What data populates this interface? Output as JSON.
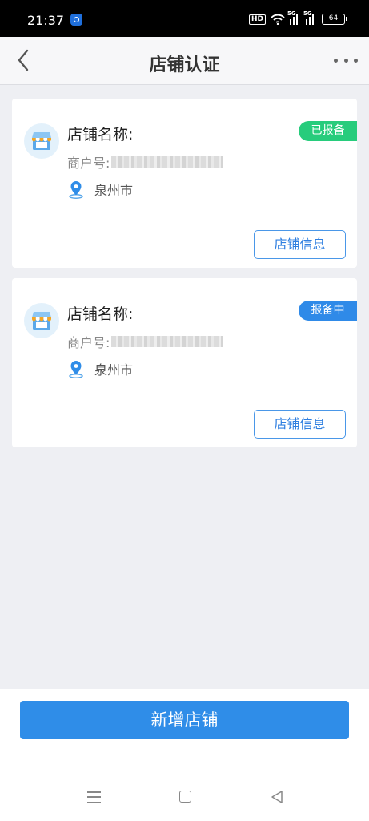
{
  "status_bar": {
    "time": "21:37",
    "hd": "HD",
    "network_1": "5G",
    "network_2": "5G",
    "battery": "64"
  },
  "nav": {
    "title": "店铺认证"
  },
  "stores": [
    {
      "name_label": "店铺名称:",
      "merchant_label": "商户号:",
      "city": "泉州市",
      "status": "已报备",
      "status_color": "#27cc7c",
      "info_button": "店铺信息"
    },
    {
      "name_label": "店铺名称:",
      "merchant_label": "商户号:",
      "city": "泉州市",
      "status": "报备中",
      "status_color": "#2f8ae8",
      "info_button": "店铺信息"
    }
  ],
  "footer": {
    "add_button": "新增店铺"
  },
  "icons": {
    "back": "chevron-left-icon",
    "more": "more-dots-icon",
    "shop": "storefront-icon",
    "location": "location-pin-icon"
  },
  "colors": {
    "primary": "#2f8de8",
    "success": "#27cc7c",
    "background": "#eeeff3"
  }
}
